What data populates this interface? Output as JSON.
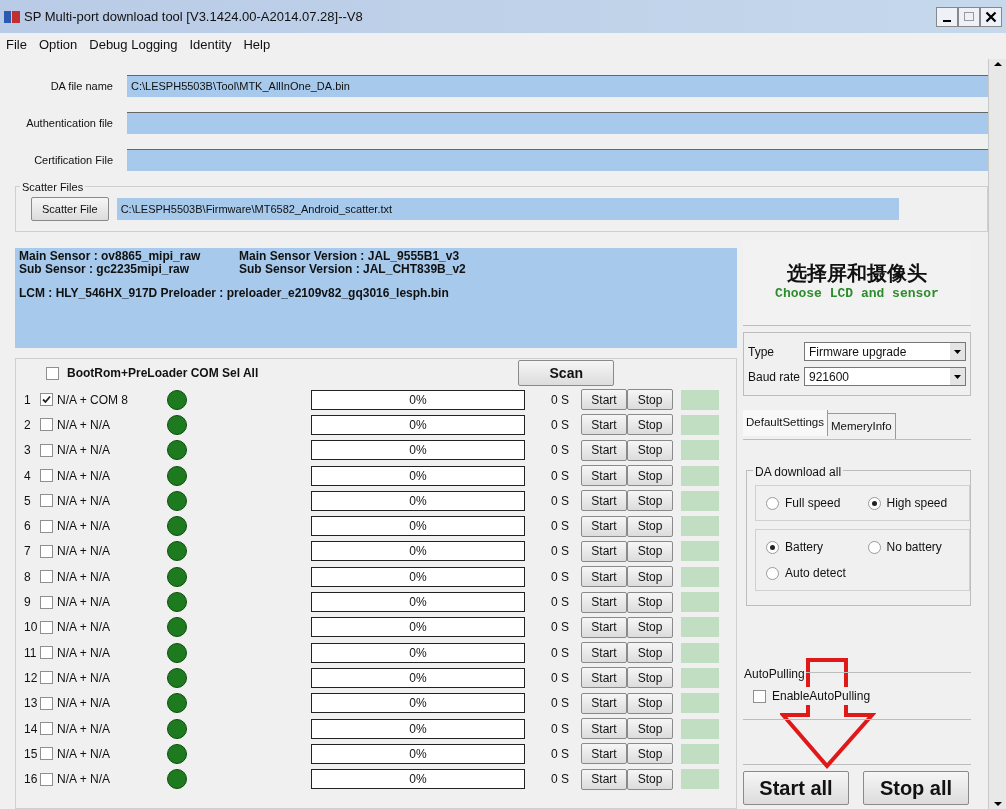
{
  "window": {
    "title": "SP Multi-port download tool [V3.1424.00-A2014.07.28]--V8"
  },
  "menu": [
    "File",
    "Option",
    "Debug Logging",
    "Identity",
    "Help"
  ],
  "fields": [
    {
      "label": "DA file name",
      "value": "C:\\LESPH5503B\\Tool\\MTK_AllInOne_DA.bin"
    },
    {
      "label": "Authentication file"
    },
    {
      "label": "Certification File"
    }
  ],
  "scatter": {
    "group_label": "Scatter Files",
    "button": "Scatter File",
    "value": "C:\\LESPH5503B\\Firmware\\MT6582_Android_scatter.txt"
  },
  "info": {
    "lines": [
      [
        "Main Sensor : ov8865_mipi_raw",
        "Main Sensor Version : JAL_9555B1_v3"
      ],
      [
        "Sub Sensor : gc2235mipi_raw",
        "Sub Sensor Version : JAL_CHT839B_v2"
      ]
    ],
    "lcm": "LCM : HLY_546HX_917D Preloader : preloader_e2109v82_gq3016_lesph.bin"
  },
  "ports": {
    "select_all": {
      "label": "BootRom+PreLoader COM Sel All",
      "checked": false
    },
    "scan_button": "Scan",
    "rows": [
      {
        "number": "1",
        "checked": true,
        "label": "N/A + COM 8",
        "progress": "0%",
        "time": "0 S",
        "start": "Start",
        "stop": "Stop"
      },
      {
        "number": "2",
        "checked": false,
        "label": "N/A + N/A",
        "progress": "0%",
        "time": "0 S",
        "start": "Start",
        "stop": "Stop"
      },
      {
        "number": "3",
        "checked": false,
        "label": "N/A + N/A",
        "progress": "0%",
        "time": "0 S",
        "start": "Start",
        "stop": "Stop"
      },
      {
        "number": "4",
        "checked": false,
        "label": "N/A + N/A",
        "progress": "0%",
        "time": "0 S",
        "start": "Start",
        "stop": "Stop"
      },
      {
        "number": "5",
        "checked": false,
        "label": "N/A + N/A",
        "progress": "0%",
        "time": "0 S",
        "start": "Start",
        "stop": "Stop"
      },
      {
        "number": "6",
        "checked": false,
        "label": "N/A + N/A",
        "progress": "0%",
        "time": "0 S",
        "start": "Start",
        "stop": "Stop"
      },
      {
        "number": "7",
        "checked": false,
        "label": "N/A + N/A",
        "progress": "0%",
        "time": "0 S",
        "start": "Start",
        "stop": "Stop"
      },
      {
        "number": "8",
        "checked": false,
        "label": "N/A + N/A",
        "progress": "0%",
        "time": "0 S",
        "start": "Start",
        "stop": "Stop"
      },
      {
        "number": "9",
        "checked": false,
        "label": "N/A + N/A",
        "progress": "0%",
        "time": "0 S",
        "start": "Start",
        "stop": "Stop"
      },
      {
        "number": "10",
        "checked": false,
        "label": "N/A + N/A",
        "progress": "0%",
        "time": "0 S",
        "start": "Start",
        "stop": "Stop"
      },
      {
        "number": "11",
        "checked": false,
        "label": "N/A + N/A",
        "progress": "0%",
        "time": "0 S",
        "start": "Start",
        "stop": "Stop"
      },
      {
        "number": "12",
        "checked": false,
        "label": "N/A + N/A",
        "progress": "0%",
        "time": "0 S",
        "start": "Start",
        "stop": "Stop"
      },
      {
        "number": "13",
        "checked": false,
        "label": "N/A + N/A",
        "progress": "0%",
        "time": "0 S",
        "start": "Start",
        "stop": "Stop"
      },
      {
        "number": "14",
        "checked": false,
        "label": "N/A + N/A",
        "progress": "0%",
        "time": "0 S",
        "start": "Start",
        "stop": "Stop"
      },
      {
        "number": "15",
        "checked": false,
        "label": "N/A + N/A",
        "progress": "0%",
        "time": "0 S",
        "start": "Start",
        "stop": "Stop"
      },
      {
        "number": "16",
        "checked": false,
        "label": "N/A + N/A",
        "progress": "0%",
        "time": "0 S",
        "start": "Start",
        "stop": "Stop"
      }
    ]
  },
  "banner": {
    "title_cn": "选择屏和摄像头",
    "title_en": "Choose LCD and sensor"
  },
  "selects": [
    {
      "label": "Type",
      "value": "Firmware upgrade"
    },
    {
      "label": "Baud rate",
      "value": "921600"
    }
  ],
  "tabs": [
    {
      "label": "DefaultSettings",
      "selected": true
    },
    {
      "label": "MemeryInfo",
      "selected": false
    }
  ],
  "da_group": {
    "label": "DA download all",
    "groups": [
      [
        {
          "label": "Full speed",
          "selected": false
        },
        {
          "label": "High speed",
          "selected": true
        }
      ],
      [
        {
          "label": "Battery",
          "selected": true
        },
        {
          "label": "No battery",
          "selected": false
        },
        {
          "label": "Auto detect",
          "selected": false
        }
      ]
    ]
  },
  "autopulling": {
    "label": "AutoPulling",
    "checkbox": {
      "label": "EnableAutoPulling",
      "checked": false
    }
  },
  "buttons": [
    "Start all",
    "Stop all"
  ]
}
